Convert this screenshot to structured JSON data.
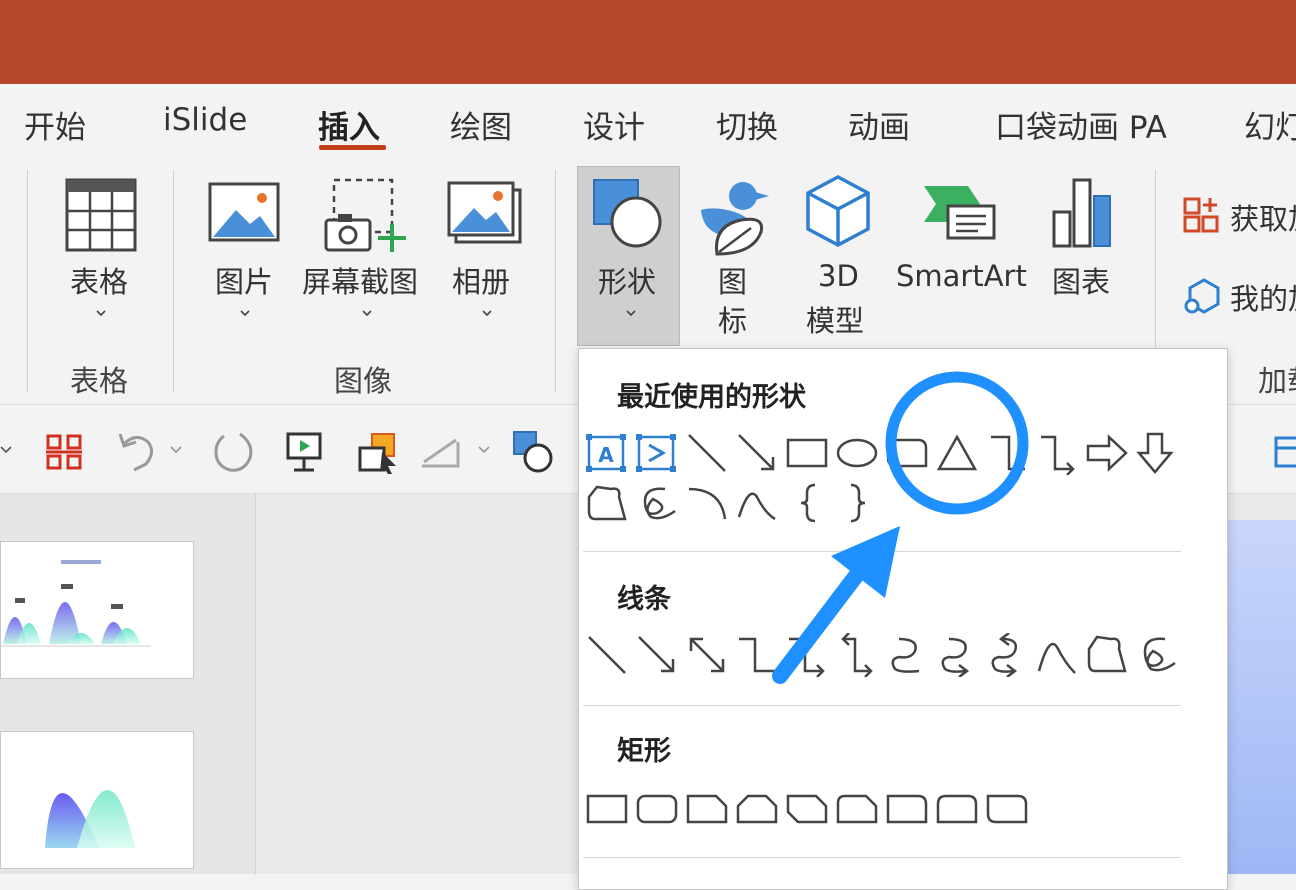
{
  "tabs": [
    {
      "label": "开始"
    },
    {
      "label": "iSlide"
    },
    {
      "label": "插入"
    },
    {
      "label": "绘图"
    },
    {
      "label": "设计"
    },
    {
      "label": "切换"
    },
    {
      "label": "动画"
    },
    {
      "label": "口袋动画 PA"
    },
    {
      "label": "幻灯"
    }
  ],
  "active_tab": "插入",
  "ribbon": {
    "table_label": "表格",
    "table_group": "表格",
    "picture_label": "图片",
    "screenshot_label": "屏幕截图",
    "album_label": "相册",
    "image_group": "图像",
    "shapes_label": "形状",
    "icons_label_1": "图",
    "icons_label_2": "标",
    "model_label_1": "3D",
    "model_label_2": "模型",
    "smartart_label": "SmartArt",
    "chart_label": "图表",
    "get_addins_label": "获取加",
    "my_addins_label": "我的加",
    "addins_group": "加载"
  },
  "shapes_menu": {
    "recent_heading": "最近使用的形状",
    "lines_heading": "线条",
    "rect_heading": "矩形"
  },
  "colors": {
    "title_bar": "#b7472a",
    "accent": "#c43e1c",
    "annotation": "#1e90ff"
  }
}
